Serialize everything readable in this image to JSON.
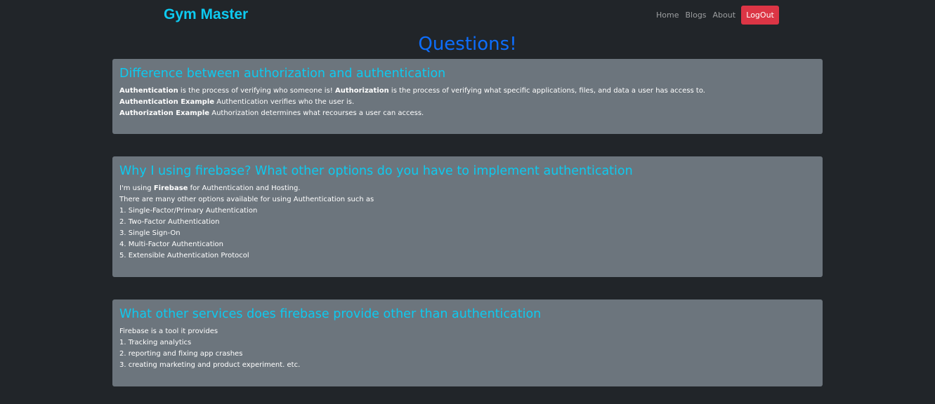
{
  "navbar": {
    "brand": "Gym Master",
    "links": [
      "Home",
      "Blogs",
      "About"
    ],
    "logout_label": "LogOut"
  },
  "page": {
    "title": "Questions!"
  },
  "qa": [
    {
      "question": "Difference between authorization and authentication",
      "lines": [
        {
          "bold": "Authentication",
          "text": " is the process of verifying who someone is! ",
          "bold2": "Authorization",
          "text2": " is the process of verifying what specific applications, files, and data a user has access to."
        },
        {
          "bold": "Authentication Example",
          "text": " Authentication verifies who the user is."
        },
        {
          "bold": "Authorization Example",
          "text": " Authorization determines what recourses a user can access."
        }
      ]
    },
    {
      "question": "Why I using firebase? What other options do you have to implement authentication",
      "lines": [
        {
          "text": "I'm using ",
          "bold": "Firebase",
          "text2": " for Authentication and Hosting."
        },
        {
          "text": "There are many other options available for using Authentication such as"
        },
        {
          "text": "1. Single-Factor/Primary Authentication"
        },
        {
          "text": "2. Two-Factor Authentication"
        },
        {
          "text": "3. Single Sign-On"
        },
        {
          "text": "4. Multi-Factor Authentication"
        },
        {
          "text": "5. Extensible Authentication Protocol"
        }
      ]
    },
    {
      "question": "What other services does firebase provide other than authentication",
      "lines": [
        {
          "text": "Firebase is a tool it provides"
        },
        {
          "text": "1. Tracking analytics"
        },
        {
          "text": "2. reporting and fixing app crashes"
        },
        {
          "text": "3. creating marketing and product experiment. etc."
        }
      ]
    }
  ]
}
